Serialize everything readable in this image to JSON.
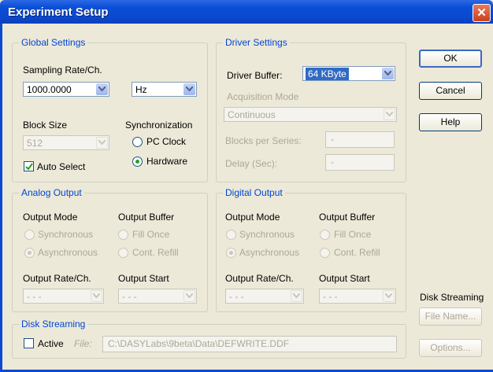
{
  "window": {
    "title": "Experiment Setup",
    "close_glyph": "✕"
  },
  "global": {
    "legend": "Global Settings",
    "sampling_label": "Sampling Rate/Ch.",
    "sampling_value": "1000.0000",
    "unit_value": "Hz",
    "block_label": "Block Size",
    "block_value": "512",
    "auto_select_label": "Auto Select",
    "auto_select_checked": true,
    "sync_label": "Synchronization",
    "sync_pc": "PC Clock",
    "sync_hw": "Hardware",
    "sync_selected": "Hardware"
  },
  "driver": {
    "legend": "Driver Settings",
    "buffer_label": "Driver Buffer:",
    "buffer_value": "64 KByte",
    "acq_label": "Acquisition Mode",
    "acq_value": "Continuous",
    "blocks_label": "Blocks per Series:",
    "blocks_value": "-",
    "delay_label": "Delay (Sec):",
    "delay_value": "-"
  },
  "analog": {
    "legend": "Analog Output",
    "mode_label": "Output Mode",
    "buffer_label": "Output Buffer",
    "sync": "Synchronous",
    "async": "Asynchronous",
    "fill_once": "Fill Once",
    "cont_refill": "Cont. Refill",
    "rate_label": "Output Rate/Ch.",
    "start_label": "Output Start",
    "rate_value": "- - -",
    "start_value": "- - -"
  },
  "digital": {
    "legend": "Digital Output",
    "mode_label": "Output Mode",
    "buffer_label": "Output Buffer",
    "sync": "Synchronous",
    "async": "Asynchronous",
    "fill_once": "Fill Once",
    "cont_refill": "Cont. Refill",
    "rate_label": "Output Rate/Ch.",
    "start_label": "Output Start",
    "rate_value": "- - -",
    "start_value": "- - -"
  },
  "disk": {
    "legend": "Disk Streaming",
    "active_label": "Active",
    "active_checked": false,
    "file_label": "File:",
    "file_value": "C:\\DASYLabs\\9beta\\Data\\DEFWRITE.DDF"
  },
  "buttons": {
    "ok": "OK",
    "cancel": "Cancel",
    "help": "Help",
    "disk_streaming_label": "Disk Streaming",
    "file_name": "File Name...",
    "options": "Options..."
  },
  "colors": {
    "accent": "#0046d5",
    "titlebar": "#0a49d2",
    "close": "#c9401c",
    "face": "#ece9d8"
  }
}
